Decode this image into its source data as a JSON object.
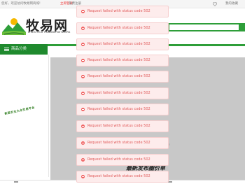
{
  "topbar": {
    "welcome": "您好，欢迎访问牧易网商城!",
    "login": "立即登录",
    "register": "免费注册",
    "favorites": "我的收藏"
  },
  "header": {
    "logo_title": "牧易网",
    "logo_subtitle": "LIVESTOCK TRADING NETWORK"
  },
  "nav": {
    "category_label": "商品分类"
  },
  "sidebar": {
    "slogan": "新型农业大众交易平台"
  },
  "banner": {
    "title": "最新发布圈价单"
  },
  "toasts": [
    "Request failed with status code 502",
    "Request failed with status code 502",
    "Request failed with status code 502",
    "Request failed with status code 502",
    "Request failed with status code 502",
    "Request failed with status code 502",
    "Request failed with status code 502",
    "Request failed with status code 502",
    "Request failed with status code 502",
    "Request failed with status code 502",
    "Request failed with status code 502"
  ],
  "colors": {
    "brand_green": "#2e9e39",
    "toast_bg": "#fdecec",
    "toast_text": "#e05a5a",
    "login_red": "#e33"
  }
}
